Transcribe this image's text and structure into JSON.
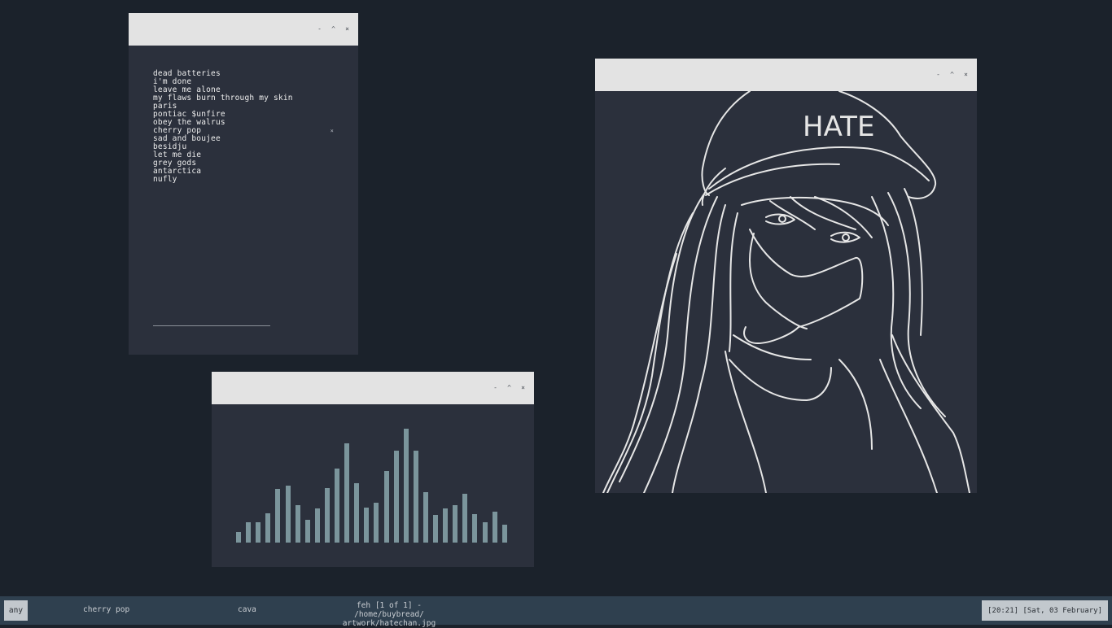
{
  "windows": {
    "player": {
      "controls": [
        "-",
        "^",
        "×"
      ]
    },
    "visualizer": {
      "controls": [
        "-",
        "^",
        "×"
      ],
      "bar_levels": [
        0.09,
        0.18,
        0.18,
        0.26,
        0.47,
        0.5,
        0.33,
        0.2,
        0.3,
        0.48,
        0.65,
        0.87,
        0.52,
        0.31,
        0.35,
        0.63,
        0.81,
        1.0,
        0.81,
        0.44,
        0.24,
        0.3,
        0.33,
        0.43,
        0.25,
        0.18,
        0.27,
        0.16
      ]
    },
    "viewer": {
      "controls": [
        "-",
        "^",
        "×"
      ],
      "artwork_text": "HATE"
    }
  },
  "playlist": {
    "tracks": [
      "dead batteries",
      "i'm done",
      "leave me alone",
      "my flaws burn through my skin",
      "paris",
      "pontiac $unfire",
      "obey the walrus",
      "cherry pop",
      "sad and boujee",
      "besidju",
      "let me die",
      "grey gods",
      "antarctica",
      "nufly"
    ],
    "current_marker": "×",
    "progress": 0.0
  },
  "bottombar": {
    "tag": "any",
    "tasks": [
      "cherry pop",
      "cava",
      "feh [1 of 1] - /home/buybread/\nartwork/hatechan.jpg"
    ],
    "clock": "[20:21] [Sat, 03 February]"
  },
  "colors": {
    "desktop": "#1b222b",
    "window_bg": "#2b303c",
    "titlebar": "#e3e3e3",
    "bar_color": "#7b959c",
    "statusbar": "#2f404f"
  }
}
